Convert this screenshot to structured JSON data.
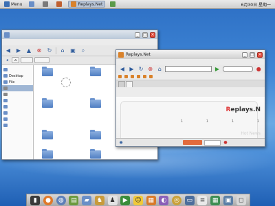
{
  "top_panel": {
    "menu_label": "Menu",
    "items": [
      {
        "label": "",
        "active": false
      },
      {
        "label": "",
        "active": false
      },
      {
        "label": "",
        "active": false
      },
      {
        "label": "Replays.Net",
        "active": true
      },
      {
        "label": "",
        "active": false
      }
    ],
    "right_text": "6月30日 星期一"
  },
  "file_manager": {
    "title": "",
    "menu": [
      "",
      "",
      "",
      "",
      ""
    ],
    "sidebar": [
      {
        "label": "",
        "type": "folder",
        "selected": false
      },
      {
        "label": "Desktop",
        "type": "folder",
        "selected": false
      },
      {
        "label": "File",
        "type": "folder",
        "selected": false
      },
      {
        "label": "",
        "type": "drive",
        "selected": true
      },
      {
        "label": "",
        "type": "drive",
        "selected": false
      },
      {
        "label": "",
        "type": "folder",
        "selected": false
      },
      {
        "label": "",
        "type": "folder",
        "selected": false
      },
      {
        "label": "",
        "type": "folder",
        "selected": false
      },
      {
        "label": "",
        "type": "folder",
        "selected": false
      },
      {
        "label": "",
        "type": "folder",
        "selected": false
      }
    ],
    "folders": [
      {
        "label": ""
      },
      {
        "label": ""
      },
      {
        "label": ""
      },
      {
        "label": ""
      },
      {
        "label": ""
      },
      {
        "label": ""
      },
      {
        "label": ""
      },
      {
        "label": ""
      }
    ]
  },
  "browser": {
    "title": "Replays.Net",
    "url": "",
    "bookmarks": [
      "",
      "",
      "",
      "",
      "",
      "",
      ""
    ],
    "tabs": [
      {
        "label": "",
        "active": false
      },
      {
        "label": "",
        "active": true
      }
    ],
    "page": {
      "logo_left": "R",
      "logo_right": "eplays.N",
      "stats": [
        {
          "label": "",
          "value": ""
        },
        {
          "label": "",
          "value": "1"
        },
        {
          "label": "",
          "value": "1"
        },
        {
          "label": "",
          "value": "1"
        },
        {
          "label": "",
          "value": "1"
        }
      ],
      "tagline": "Hot News"
    }
  },
  "dock": {
    "items": [
      "terminal-icon",
      "firefox-icon",
      "network-icon",
      "books-icon",
      "folder-icon",
      "chess-icon",
      "game-icon",
      "media-icon",
      "user-icon",
      "calculator-icon",
      "image-icon",
      "media-player-icon",
      "monitor-icon",
      "text-editor-icon",
      "calendar-icon",
      "display-icon",
      "window-icon"
    ]
  }
}
